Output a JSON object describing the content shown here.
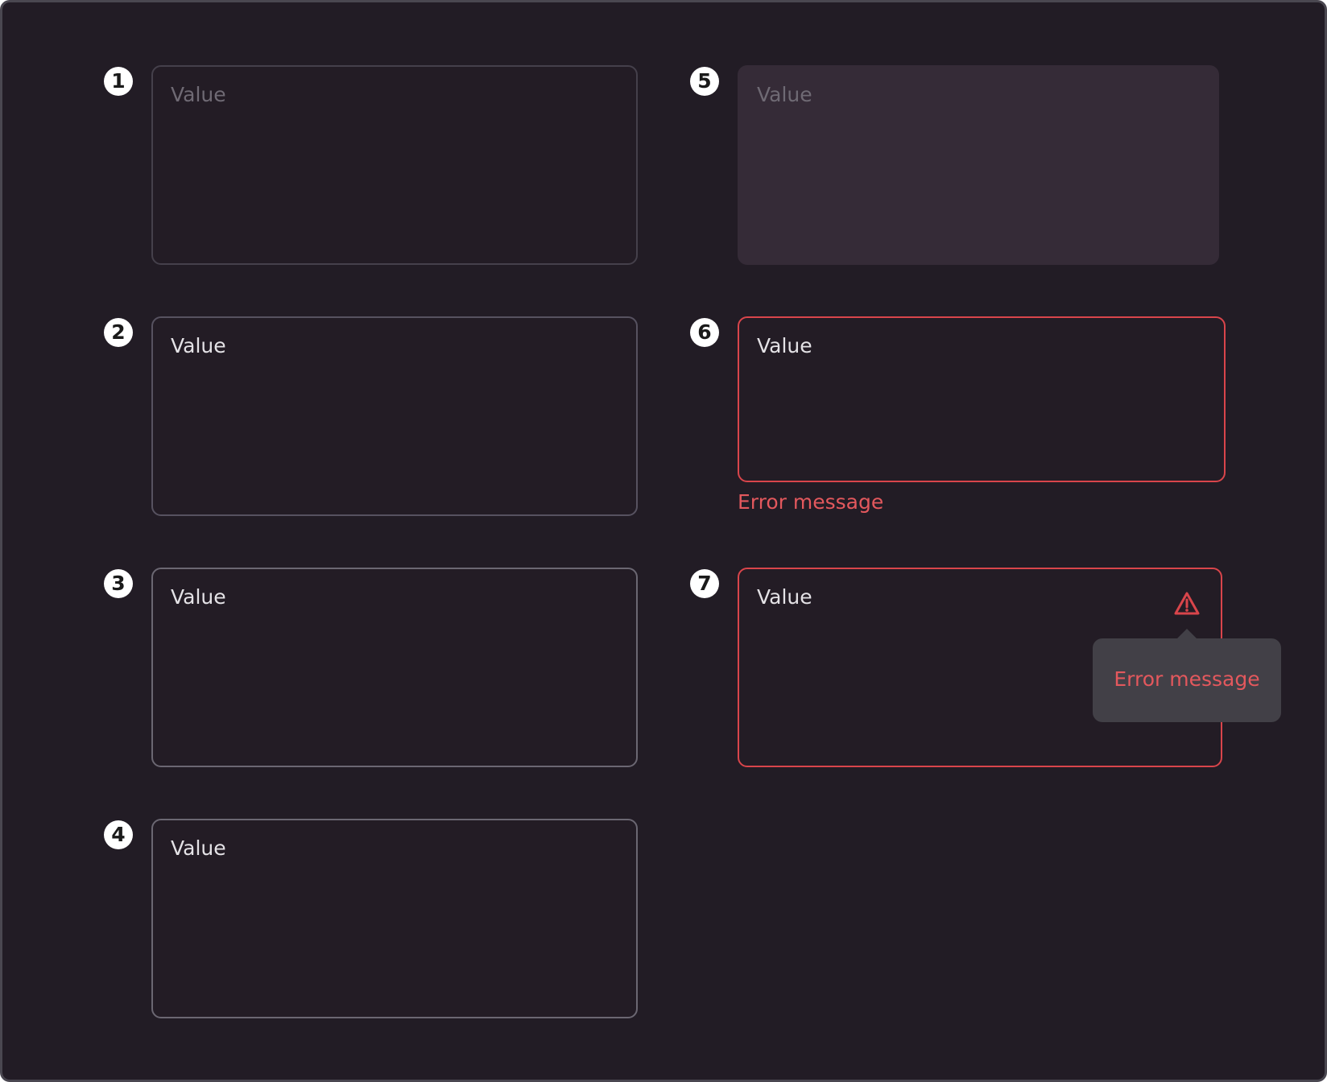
{
  "examples": [
    {
      "number": "1",
      "state": "default",
      "value": "Value"
    },
    {
      "number": "2",
      "state": "hover",
      "value": "Value"
    },
    {
      "number": "3",
      "state": "focus",
      "value": "Value"
    },
    {
      "number": "4",
      "state": "filled",
      "value": "Value"
    },
    {
      "number": "5",
      "state": "disabled",
      "value": "Value"
    },
    {
      "number": "6",
      "state": "error",
      "value": "Value",
      "error": "Error message"
    },
    {
      "number": "7",
      "state": "error-tooltip",
      "value": "Value",
      "error": "Error message",
      "icon": "warning-triangle-icon"
    }
  ],
  "colors": {
    "background": "#221c25",
    "border": "#45404b",
    "error": "#d9454b",
    "error_text": "#e3585d",
    "disabled_fill": "#352b37",
    "tooltip": "#424047"
  }
}
